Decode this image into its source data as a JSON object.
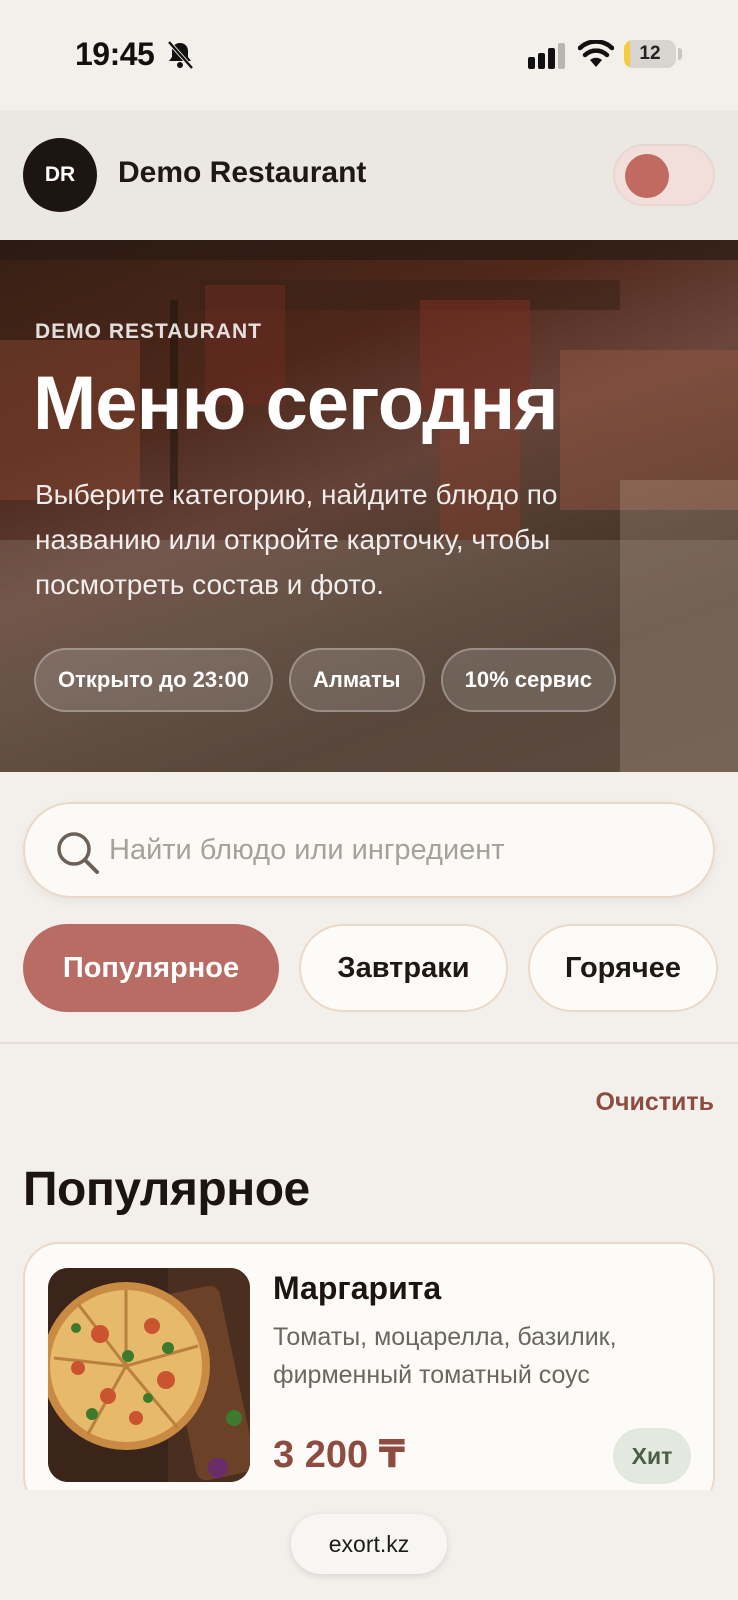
{
  "status_bar": {
    "time": "19:45",
    "battery": "12",
    "battery_level": 0.12,
    "icons": [
      "bell-muted-icon",
      "signal-icon",
      "wifi-icon",
      "battery-icon"
    ]
  },
  "header": {
    "avatar_initials": "DR",
    "restaurant_name": "Demo Restaurant",
    "toggle_icon": "theme-toggle"
  },
  "hero": {
    "eyebrow": "DEMO RESTAURANT",
    "title": "Меню сегодня",
    "subtitle": "Выберите категорию, найдите блюдо по названию или откройте карточку, чтобы посмотреть состав и фото.",
    "chips": [
      {
        "label": "Открыто до 23:00"
      },
      {
        "label": "Алматы"
      },
      {
        "label": "10% сервис"
      }
    ]
  },
  "search": {
    "placeholder": "Найти блюдо или ингредиент",
    "value": "",
    "icon": "search-icon"
  },
  "categories": [
    {
      "label": "Популярное",
      "active": true
    },
    {
      "label": "Завтраки",
      "active": false
    },
    {
      "label": "Горячее",
      "active": false
    }
  ],
  "clear_label": "Очистить",
  "section_title": "Популярное",
  "dishes": [
    {
      "name": "Маргарита",
      "description": "Томаты, моцарелла, базилик, фирменный томатный соус",
      "price": "3 200 ₸",
      "badge": "Хит"
    }
  ],
  "browser": {
    "url": "exort.kz"
  },
  "colors": {
    "accent": "#b96c63",
    "price": "#8e4b40",
    "background": "#f3f0ec",
    "badge_bg": "#e4e9e0"
  }
}
